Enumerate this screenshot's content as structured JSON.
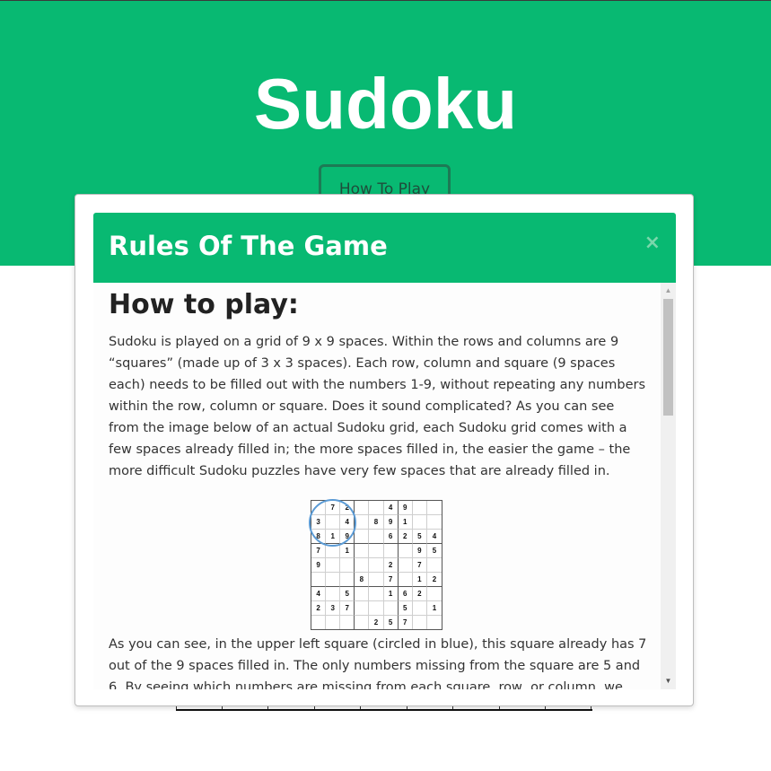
{
  "page": {
    "title": "Sudoku",
    "how_to_play_button": "How To Play"
  },
  "modal": {
    "title": "Rules Of The Game",
    "close_symbol": "×",
    "heading": "How to play:",
    "paragraph_1": "Sudoku is played on a grid of 9 x 9 spaces. Within the rows and columns are 9 “squares” (made up of 3 x 3 spaces). Each row, column and square (9 spaces each) needs to be filled out with the numbers 1-9, without repeating any numbers within the row, column or square. Does it sound complicated? As you can see from the image below of an actual Sudoku grid, each Sudoku grid comes with a few spaces already filled in; the more spaces filled in, the easier the game – the more difficult Sudoku puzzles have very few spaces that are already filled in.",
    "paragraph_2": "As you can see, in the upper left square (circled in blue), this square already has 7 out of the 9 spaces filled in. The only numbers missing from the square are 5 and 6. By seeing which numbers are missing from each square, row, or column, we can use",
    "example_grid": [
      [
        "",
        "7",
        "2",
        "",
        "",
        "4",
        "9",
        "",
        ""
      ],
      [
        "3",
        "",
        "4",
        "",
        "8",
        "9",
        "1",
        "",
        ""
      ],
      [
        "8",
        "1",
        "9",
        "",
        "",
        "6",
        "2",
        "5",
        "4"
      ],
      [
        "7",
        "",
        "1",
        "",
        "",
        "",
        "",
        "9",
        "5"
      ],
      [
        "9",
        "",
        "",
        "",
        "",
        "2",
        "",
        "7",
        ""
      ],
      [
        "",
        "",
        "",
        "8",
        "",
        "7",
        "",
        "1",
        "2"
      ],
      [
        "4",
        "",
        "5",
        "",
        "",
        "1",
        "6",
        "2",
        ""
      ],
      [
        "2",
        "3",
        "7",
        "",
        "",
        "",
        "5",
        "",
        "1"
      ],
      [
        "",
        "",
        "",
        "",
        "2",
        "5",
        "7",
        "",
        ""
      ]
    ],
    "highlight_color": "#5b9bd5"
  },
  "colors": {
    "brand_green": "#08b972",
    "button_border": "#1d7a55"
  },
  "icons": {
    "close": "close-icon",
    "scroll_up": "chevron-up-icon",
    "scroll_down": "chevron-down-icon"
  }
}
